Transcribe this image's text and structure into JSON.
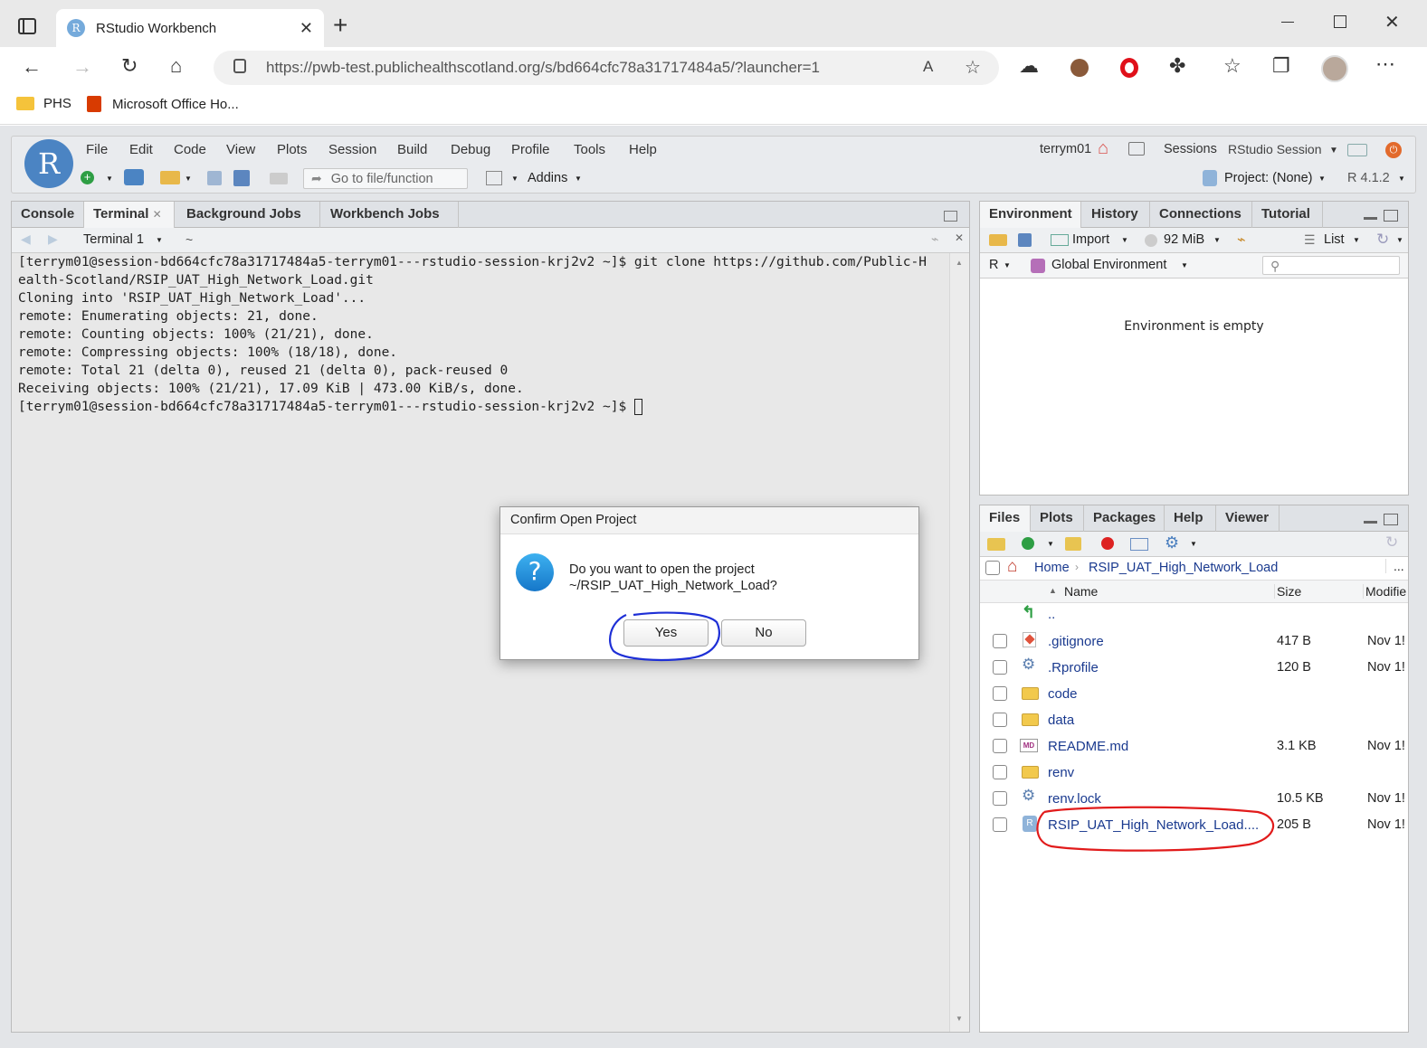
{
  "browser": {
    "tab_title": "RStudio Workbench",
    "new_tab": "+",
    "url": "https://pwb-test.publichealthscotland.org/s/bd664cfc78a31717484a5/?launcher=1",
    "favorites": [
      "PHS",
      "Microsoft Office Ho..."
    ]
  },
  "rstudio": {
    "menu": [
      "File",
      "Edit",
      "Code",
      "View",
      "Plots",
      "Session",
      "Build",
      "Debug",
      "Profile",
      "Tools",
      "Help"
    ],
    "user": "terrym01",
    "sessions_label": "Sessions",
    "session_name": "RStudio Session",
    "goto_placeholder": "Go to file/function",
    "addins": "Addins",
    "project": "Project: (None)",
    "r_version": "R 4.1.2"
  },
  "left_pane": {
    "tabs": [
      "Console",
      "Terminal",
      "Background Jobs",
      "Workbench Jobs"
    ],
    "terminal_select": "Terminal 1",
    "path": "~",
    "lines": [
      "[terrym01@session-bd664cfc78a31717484a5-terrym01---rstudio-session-krj2v2 ~]$ git clone https://github.com/Public-H",
      "ealth-Scotland/RSIP_UAT_High_Network_Load.git",
      "Cloning into 'RSIP_UAT_High_Network_Load'...",
      "remote: Enumerating objects: 21, done.",
      "remote: Counting objects: 100% (21/21), done.",
      "remote: Compressing objects: 100% (18/18), done.",
      "remote: Total 21 (delta 0), reused 21 (delta 0), pack-reused 0",
      "Receiving objects: 100% (21/21), 17.09 KiB | 473.00 KiB/s, done.",
      "[terrym01@session-bd664cfc78a31717484a5-terrym01---rstudio-session-krj2v2 ~]$ "
    ]
  },
  "env_pane": {
    "tabs": [
      "Environment",
      "History",
      "Connections",
      "Tutorial"
    ],
    "import": "Import",
    "memory": "92 MiB",
    "list": "List",
    "lang": "R",
    "scope": "Global Environment",
    "empty_msg": "Environment is empty"
  },
  "files_pane": {
    "tabs": [
      "Files",
      "Plots",
      "Packages",
      "Help",
      "Viewer"
    ],
    "breadcrumb": [
      "Home",
      "RSIP_UAT_High_Network_Load"
    ],
    "more": "...",
    "columns": {
      "name": "Name",
      "size": "Size",
      "modified": "Modifie"
    },
    "parent": "..",
    "files": [
      {
        "name": ".gitignore",
        "size": "417 B",
        "modified": "Nov 1!",
        "type": "git"
      },
      {
        "name": ".Rprofile",
        "size": "120 B",
        "modified": "Nov 1!",
        "type": "gear"
      },
      {
        "name": "code",
        "size": "",
        "modified": "",
        "type": "folder"
      },
      {
        "name": "data",
        "size": "",
        "modified": "",
        "type": "folder"
      },
      {
        "name": "README.md",
        "size": "3.1 KB",
        "modified": "Nov 1!",
        "type": "md"
      },
      {
        "name": "renv",
        "size": "",
        "modified": "",
        "type": "folder"
      },
      {
        "name": "renv.lock",
        "size": "10.5 KB",
        "modified": "Nov 1!",
        "type": "gear"
      },
      {
        "name": "RSIP_UAT_High_Network_Load....",
        "size": "205 B",
        "modified": "Nov 1!",
        "type": "rproj"
      }
    ]
  },
  "dialog": {
    "title": "Confirm Open Project",
    "message_line1": "Do you want to open the project",
    "message_line2": "~/RSIP_UAT_High_Network_Load?",
    "yes": "Yes",
    "no": "No"
  },
  "annotation_colors": {
    "yes_circle": "#1e2fd6",
    "file_circle": "#e11b1b"
  }
}
